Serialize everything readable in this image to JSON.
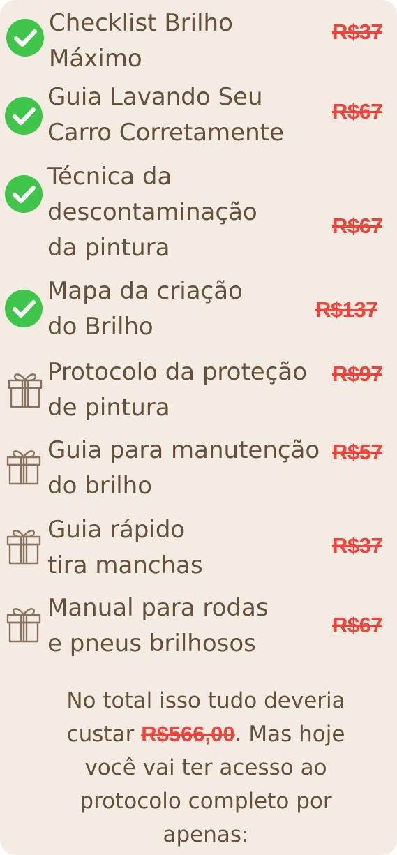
{
  "items": [
    {
      "label": "Checklist Brilho\nMáximo",
      "price": "R$37",
      "icon": "check-icon"
    },
    {
      "label": "Guia Lavando Seu\nCarro Corretamente",
      "price": "R$67",
      "icon": "check-icon"
    },
    {
      "label": "Técnica da\ndescontaminação\nda pintura",
      "price": "R$67",
      "icon": "check-icon"
    },
    {
      "label": "Mapa da criação\ndo Brilho",
      "price": "R$137",
      "icon": "check-icon"
    },
    {
      "label": "Protocolo da proteção\nde pintura",
      "price": "R$97",
      "icon": "gift-icon"
    },
    {
      "label": "Guia para manutenção\ndo brilho",
      "price": "R$57",
      "icon": "gift-icon"
    },
    {
      "label": "Guia rápido\ntira manchas",
      "price": "R$37",
      "icon": "gift-icon"
    },
    {
      "label": "Manual para rodas\ne pneus brilhosos",
      "price": "R$67",
      "icon": "gift-icon"
    }
  ],
  "summary": {
    "text_before": "No total isso tudo deveria custar ",
    "total_price": "R$566,00",
    "text_after": ". Mas hoje você vai ter acesso ao protocolo completo por apenas:"
  },
  "colors": {
    "background": "#f4ece2",
    "text": "#65513a",
    "price_strike": "#f4423a",
    "check_green": "#3fc64a",
    "gift_outline": "#8a7460"
  }
}
